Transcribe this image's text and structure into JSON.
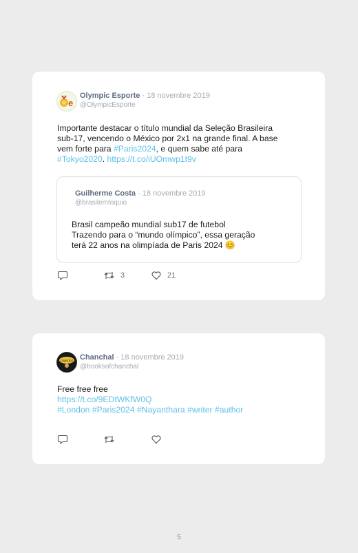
{
  "tweets": [
    {
      "author": "Olympic Esporte",
      "date": "· 18 novembre 2019",
      "handle": "@OlympicEsporte",
      "text_lines": [
        "Importante destacar o título mundial da Seleção Brasileira",
        "sub-17, vencendo o México por 2x1 na grande final. A base",
        "vem forte para "
      ],
      "hashtag_paris": "#Paris2024",
      "text_after_hashtag": ", e quem sabe até para",
      "hashtag_tokyo": "#Tokyo2020",
      "link": "https://t.co/iUOmwp1t9v",
      "quote": {
        "author": "Guilherme Costa",
        "date": "· 18 novembre 2019",
        "handle": "@brasilemtoquio",
        "text_lines": [
          "Brasil campeão mundial sub17 de futebol",
          "Trazendo para o “mundo olímpico”, essa geração",
          "terá 22 anos na olimpíada de Paris 2024 "
        ],
        "emoji": "😊"
      },
      "retweets": "3",
      "likes": "21"
    },
    {
      "author": "Chanchal",
      "date": "· 18 novembre 2019",
      "handle": "@booksofchanchal",
      "text": "Free free free",
      "link": "https://t.co/9EDtWKfW0Q",
      "hashtags": "#London #Paris2024 #Nayanthara #writer #author",
      "retweets": "",
      "likes": ""
    }
  ],
  "page_number": "5",
  "colors": {
    "link": "#5ec0e8",
    "author": "#5e6c80",
    "muted": "#a6aab1",
    "background": "#ececec"
  },
  "icons": [
    "reply-icon",
    "retweet-icon",
    "heart-icon"
  ]
}
